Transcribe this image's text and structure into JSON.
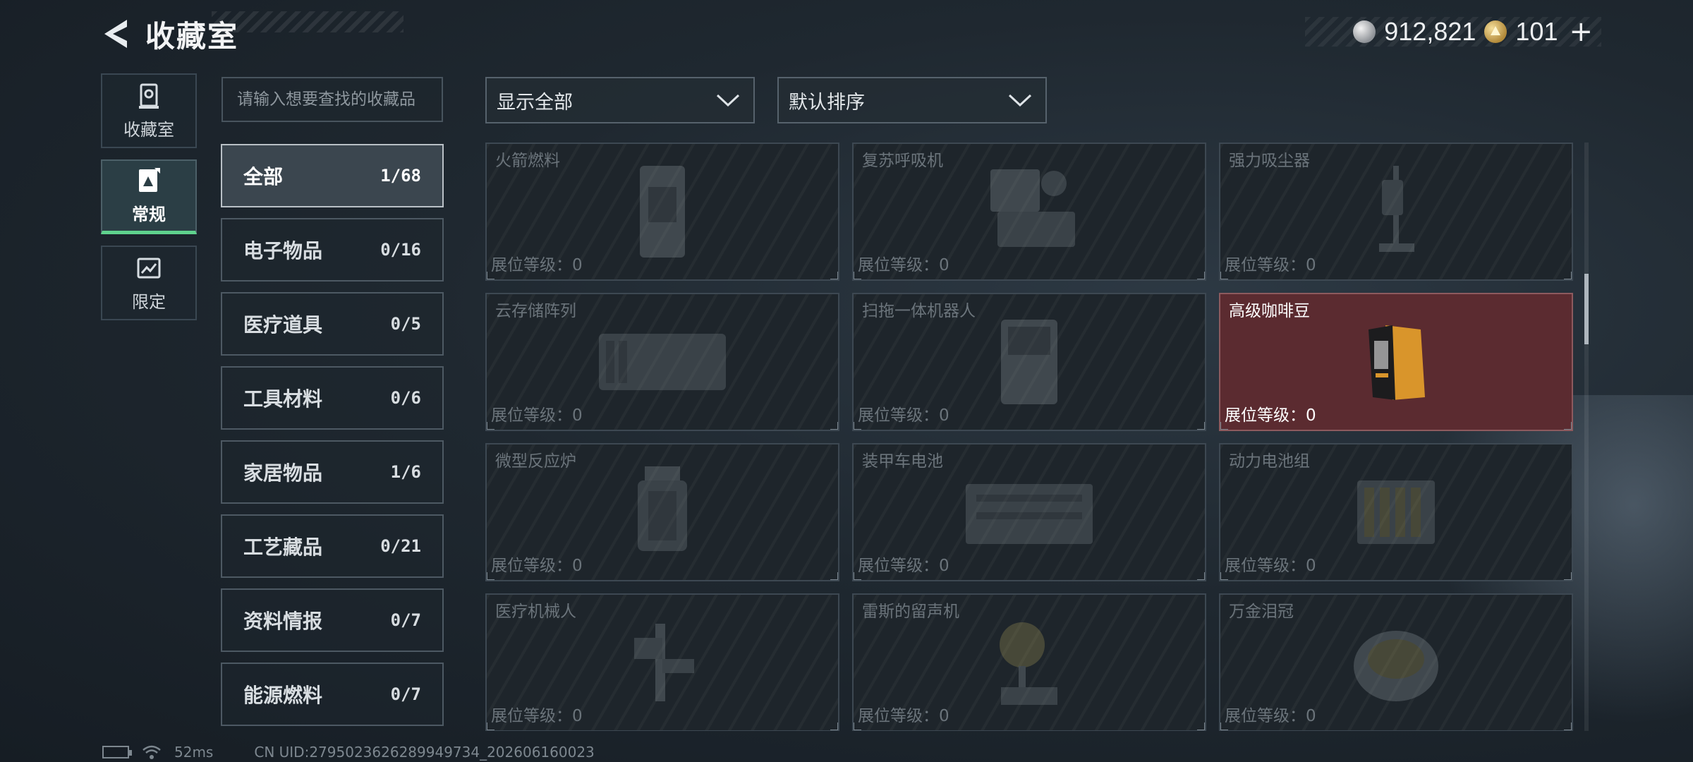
{
  "header": {
    "title": "收藏室",
    "currency": [
      {
        "icon": "silver-coin-icon",
        "value": "912,821"
      },
      {
        "icon": "gold-coin-icon",
        "value": "101",
        "add": "+"
      }
    ]
  },
  "nav": [
    {
      "label": "收藏室",
      "icon": "collection-room-icon",
      "active": false
    },
    {
      "label": "常规",
      "icon": "regular-icon",
      "active": true
    },
    {
      "label": "限定",
      "icon": "limited-icon",
      "active": false
    }
  ],
  "search": {
    "placeholder": "请输入想要查找的收藏品"
  },
  "categories": [
    {
      "name": "全部",
      "count": "1/68",
      "active": true
    },
    {
      "name": "电子物品",
      "count": "0/16"
    },
    {
      "name": "医疗道具",
      "count": "0/5"
    },
    {
      "name": "工具材料",
      "count": "0/6"
    },
    {
      "name": "家居物品",
      "count": "1/6"
    },
    {
      "name": "工艺藏品",
      "count": "0/21"
    },
    {
      "name": "资料情报",
      "count": "0/7"
    },
    {
      "name": "能源燃料",
      "count": "0/7"
    }
  ],
  "filters": {
    "display": "显示全部",
    "sort": "默认排序"
  },
  "items": [
    {
      "name": "火箭燃料",
      "level": "展位等级：0",
      "owned": false
    },
    {
      "name": "复苏呼吸机",
      "level": "展位等级：0",
      "owned": false
    },
    {
      "name": "强力吸尘器",
      "level": "展位等级：0",
      "owned": false
    },
    {
      "name": "云存储阵列",
      "level": "展位等级：0",
      "owned": false
    },
    {
      "name": "扫拖一体机器人",
      "level": "展位等级：0",
      "owned": false
    },
    {
      "name": "高级咖啡豆",
      "level": "展位等级：0",
      "owned": true
    },
    {
      "name": "微型反应炉",
      "level": "展位等级：0",
      "owned": false
    },
    {
      "name": "装甲车电池",
      "level": "展位等级：0",
      "owned": false
    },
    {
      "name": "动力电池组",
      "level": "展位等级：0",
      "owned": false
    },
    {
      "name": "医疗机械人",
      "level": "展位等级：0",
      "owned": false
    },
    {
      "name": "雷斯的留声机",
      "level": "展位等级：0",
      "owned": false
    },
    {
      "name": "万金泪冠",
      "level": "展位等级：0",
      "owned": false
    }
  ],
  "footer": {
    "ping": "52ms",
    "uid": "CN UID:2795023626289949734_202606160023"
  },
  "colors": {
    "accent_green": "#5fd28d",
    "owned_card": "#5b2b30"
  }
}
